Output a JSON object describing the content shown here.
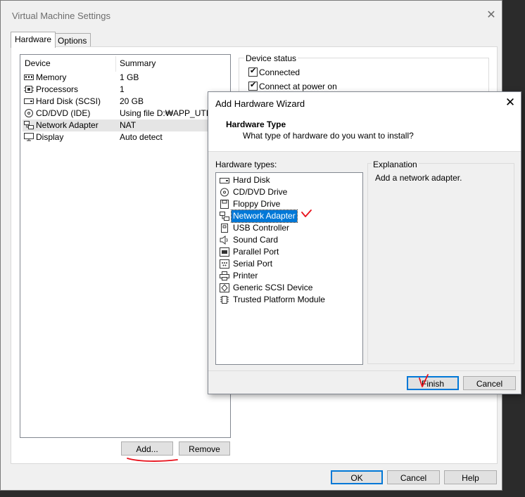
{
  "vm_settings": {
    "title": "Virtual Machine Settings",
    "close_glyph": "✕",
    "tabs": [
      {
        "label": "Hardware"
      },
      {
        "label": "Options"
      }
    ],
    "device_list": {
      "headers": {
        "device": "Device",
        "summary": "Summary"
      },
      "rows": [
        {
          "icon": "memory-icon",
          "name": "Memory",
          "summary": "1 GB"
        },
        {
          "icon": "processor-icon",
          "name": "Processors",
          "summary": "1"
        },
        {
          "icon": "hard-disk-icon",
          "name": "Hard Disk (SCSI)",
          "summary": "20 GB"
        },
        {
          "icon": "cd-dvd-icon",
          "name": "CD/DVD (IDE)",
          "summary": "Using file D:₩APP_UTIL₩("
        },
        {
          "icon": "network-adapter-icon",
          "name": "Network Adapter",
          "summary": "NAT"
        },
        {
          "icon": "display-icon",
          "name": "Display",
          "summary": "Auto detect"
        }
      ]
    },
    "device_status": {
      "title": "Device status",
      "connected_label": "Connected",
      "connect_power_label": "Connect at power on",
      "connected_checked": true,
      "connect_power_checked": true
    },
    "buttons": {
      "add": "Add...",
      "remove": "Remove",
      "ok": "OK",
      "cancel": "Cancel",
      "help": "Help"
    }
  },
  "wizard": {
    "title": "Add Hardware Wizard",
    "close_glyph": "✕",
    "header_title": "Hardware Type",
    "header_subtitle": "What type of hardware do you want to install?",
    "hardware_types_label": "Hardware types:",
    "hardware_types": [
      {
        "icon": "hard-disk-icon",
        "label": "Hard Disk"
      },
      {
        "icon": "cd-dvd-icon",
        "label": "CD/DVD Drive"
      },
      {
        "icon": "floppy-icon",
        "label": "Floppy Drive"
      },
      {
        "icon": "network-adapter-icon",
        "label": "Network Adapter",
        "selected": true
      },
      {
        "icon": "usb-icon",
        "label": "USB Controller"
      },
      {
        "icon": "sound-card-icon",
        "label": "Sound Card"
      },
      {
        "icon": "parallel-port-icon",
        "label": "Parallel Port"
      },
      {
        "icon": "serial-port-icon",
        "label": "Serial Port"
      },
      {
        "icon": "printer-icon",
        "label": "Printer"
      },
      {
        "icon": "scsi-device-icon",
        "label": "Generic SCSI Device"
      },
      {
        "icon": "tpm-icon",
        "label": "Trusted Platform Module"
      }
    ],
    "explanation_title": "Explanation",
    "explanation_text": "Add a network adapter.",
    "buttons": {
      "finish": "Finish",
      "cancel": "Cancel"
    }
  },
  "colors": {
    "selection": "#0078d7",
    "annotation": "#e8101a"
  }
}
